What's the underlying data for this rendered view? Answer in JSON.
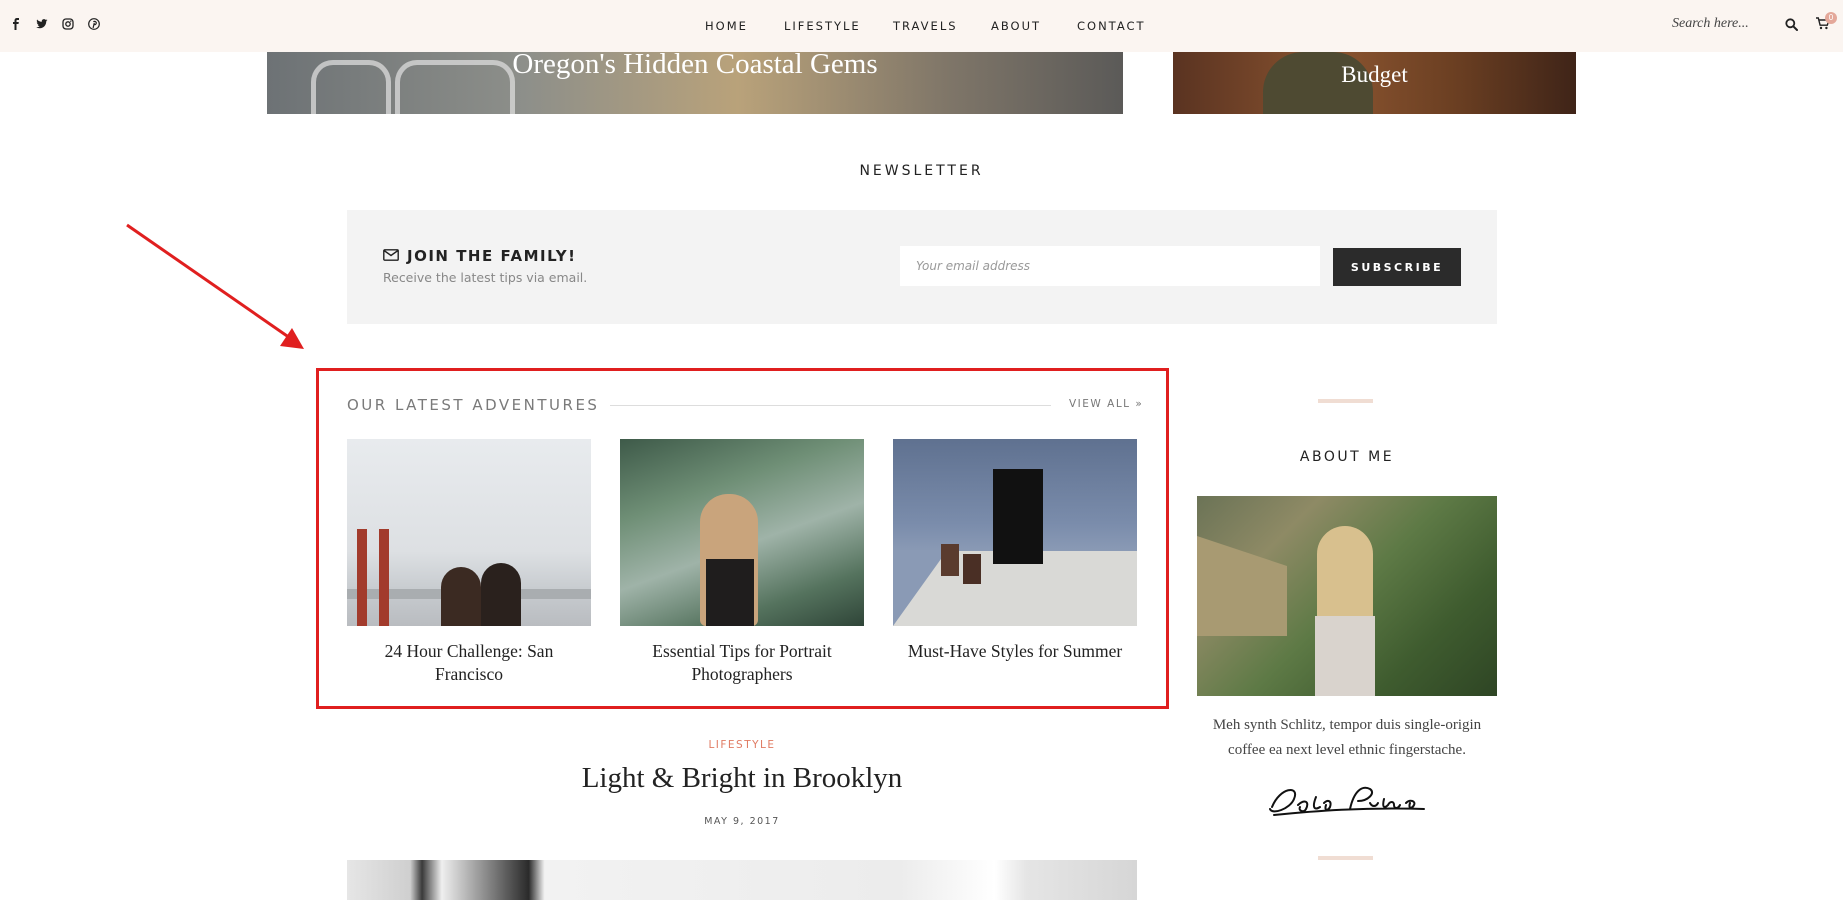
{
  "nav": {
    "social_icons": [
      "facebook-icon",
      "twitter-icon",
      "instagram-icon",
      "pinterest-icon"
    ],
    "items": [
      "HOME",
      "LIFESTYLE",
      "TRAVELS",
      "ABOUT",
      "CONTACT"
    ],
    "search_placeholder": "Search here...",
    "cart_count": "0"
  },
  "hero": {
    "left_title": "Oregon's Hidden Coastal Gems",
    "right_title": "Budget"
  },
  "newsletter": {
    "heading": "NEWSLETTER",
    "title": "JOIN THE FAMILY!",
    "subtitle": "Receive the latest tips via email.",
    "email_placeholder": "Your email address",
    "button": "SUBSCRIBE"
  },
  "latest": {
    "heading": "OUR LATEST ADVENTURES",
    "view_all": "VIEW ALL »",
    "posts": [
      {
        "title": "24 Hour Challenge: San Francisco"
      },
      {
        "title": "Essential Tips for Portrait Photographers"
      },
      {
        "title": "Must-Have Styles for Summer"
      }
    ]
  },
  "post": {
    "category": "LIFESTYLE",
    "title": "Light & Bright in Brooklyn",
    "date": "MAY 9, 2017"
  },
  "sidebar": {
    "heading": "ABOUT ME",
    "text": "Meh synth Schlitz, tempor duis single-origin coffee ea next level ethnic fingerstache.",
    "signature": "Solo Pine"
  },
  "colors": {
    "accent": "#e07b63",
    "highlight": "#e01f1f",
    "topbar": "#fbf5f1"
  }
}
